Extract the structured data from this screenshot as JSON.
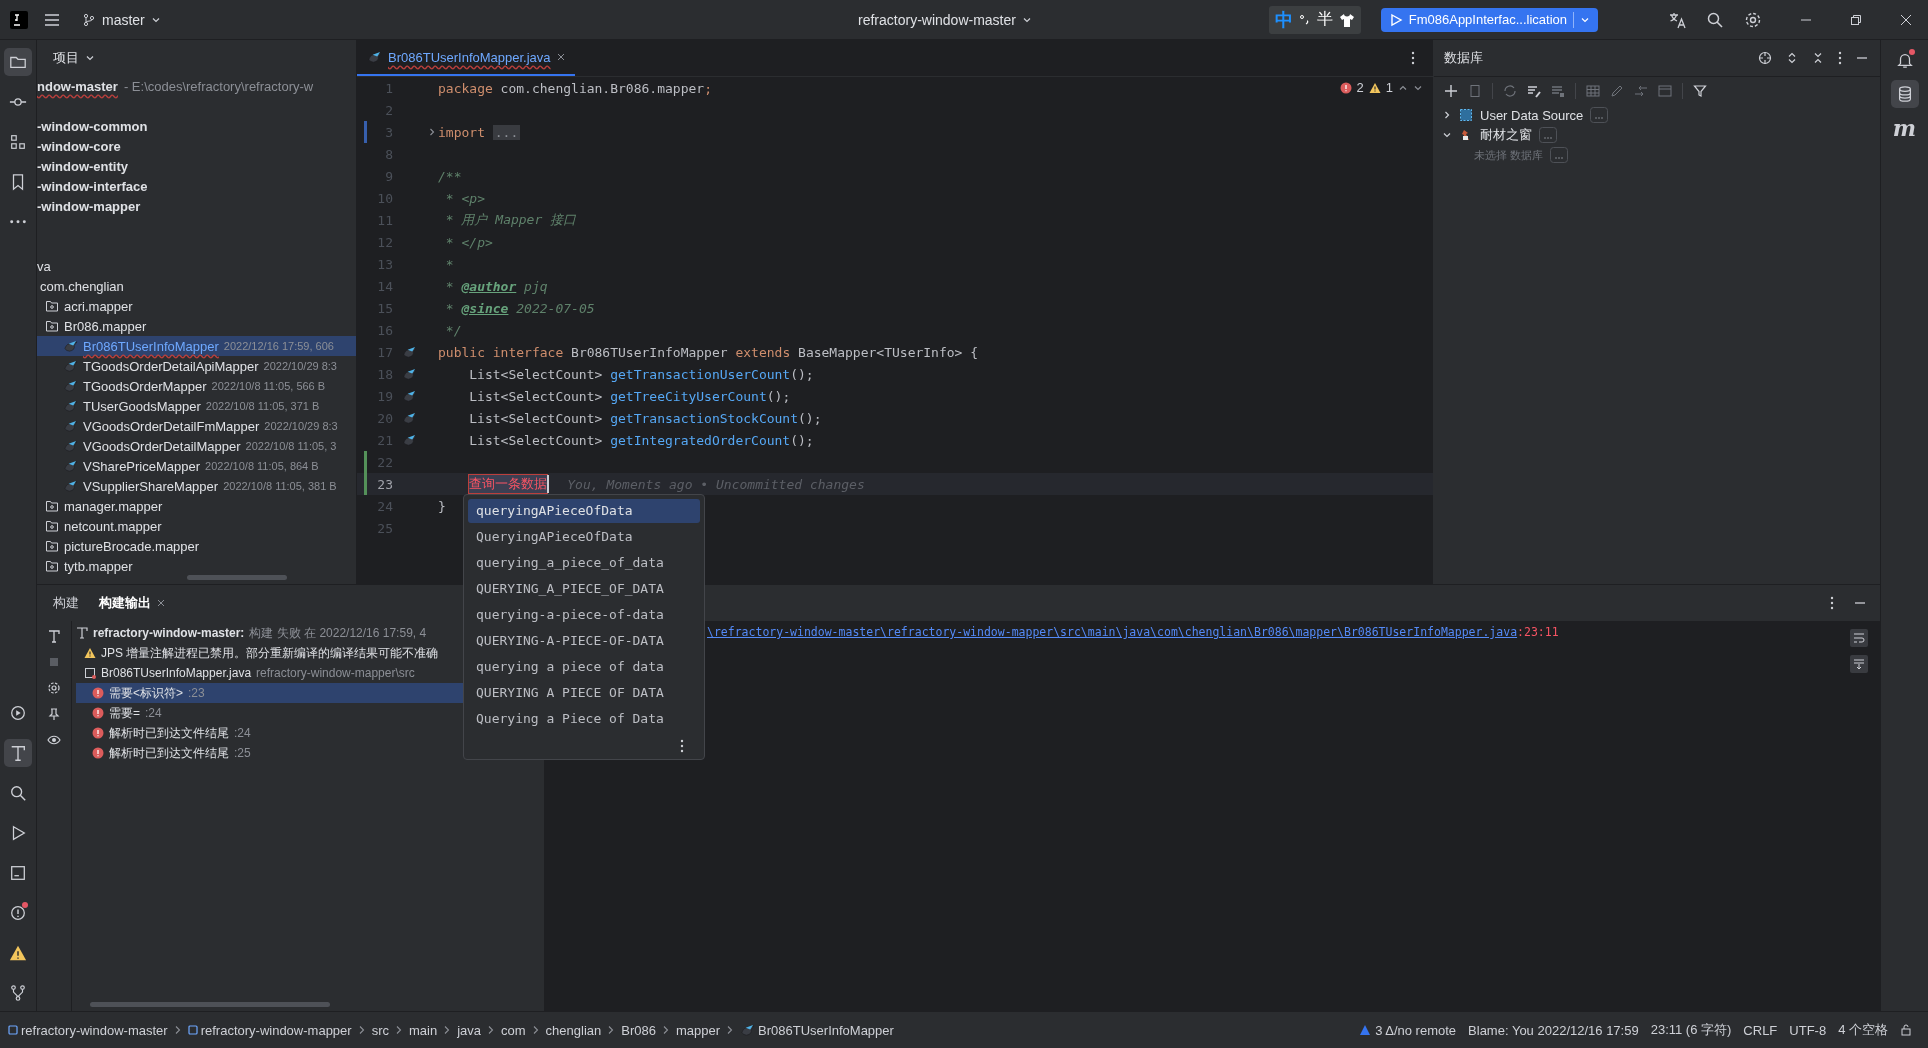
{
  "title_bar": {
    "branch": "master",
    "project": "refractory-window-master",
    "ime": [
      "中",
      "半"
    ],
    "run_config": "Fm086AppInterfac...lication"
  },
  "tool_strip": {
    "top": [
      {
        "selected": true
      },
      {
        "selected": false
      },
      {
        "selected": false
      },
      {
        "selected": false
      },
      {
        "selected": false
      }
    ],
    "bottom": [
      {
        "selected": false,
        "unread": false
      },
      {
        "selected": true,
        "unread": false
      },
      {
        "selected": false,
        "unread": false
      },
      {
        "selected": false,
        "unread": false
      },
      {
        "selected": false,
        "unread": false
      },
      {
        "selected": false,
        "unread": true
      },
      {
        "selected": false,
        "unread": false
      },
      {
        "selected": false,
        "unread": false
      }
    ]
  },
  "right_strip": [
    {
      "selected": false,
      "unread": true
    },
    {
      "selected": true,
      "unread": false
    },
    {
      "selected": false,
      "unread": false,
      "label": "m"
    }
  ],
  "project_panel": {
    "title": "项目",
    "root": {
      "name": "ndow-master",
      "path": "- E:\\codes\\refractory\\refractory-w"
    },
    "modules": [
      "-window-common",
      "-window-core",
      "-window-entity",
      "-window-interface",
      "-window-mapper"
    ],
    "tree": [
      {
        "name": "va",
        "selected": false,
        "children": [
          {
            "name": "com.chenglian",
            "selected": false,
            "children": [
              {
                "name": "acri.mapper",
                "kind": "package",
                "selected": false
              },
              {
                "name": "Br086.mapper",
                "kind": "package",
                "selected": false,
                "children": [
                  {
                    "name": "Br086TUserInfoMapper",
                    "meta": "2022/12/16 17:59, 606",
                    "kind": "mapper",
                    "selected": true
                  },
                  {
                    "name": "TGoodsOrderDetailApiMapper",
                    "meta": "2022/10/29 8:3",
                    "kind": "mapper",
                    "selected": false
                  },
                  {
                    "name": "TGoodsOrderMapper",
                    "meta": "2022/10/8 11:05, 566 B",
                    "kind": "mapper",
                    "selected": false
                  },
                  {
                    "name": "TUserGoodsMapper",
                    "meta": "2022/10/8 11:05, 371 B",
                    "kind": "mapper",
                    "selected": false
                  },
                  {
                    "name": "VGoodsOrderDetailFmMapper",
                    "meta": "2022/10/29 8:3",
                    "kind": "mapper",
                    "selected": false
                  },
                  {
                    "name": "VGoodsOrderDetailMapper",
                    "meta": "2022/10/8 11:05, 3",
                    "kind": "mapper",
                    "selected": false
                  },
                  {
                    "name": "VSharePriceMapper",
                    "meta": "2022/10/8 11:05, 864 B",
                    "kind": "mapper",
                    "selected": false
                  },
                  {
                    "name": "VSupplierShareMapper",
                    "meta": "2022/10/8 11:05, 381 B",
                    "kind": "mapper",
                    "selected": false
                  }
                ]
              },
              {
                "name": "manager.mapper",
                "kind": "package",
                "selected": false
              },
              {
                "name": "netcount.mapper",
                "kind": "package",
                "selected": false
              },
              {
                "name": "pictureBrocade.mapper",
                "kind": "package",
                "selected": false
              },
              {
                "name": "tytb.mapper",
                "kind": "package",
                "selected": false
              }
            ]
          }
        ]
      }
    ]
  },
  "editor": {
    "tab": {
      "label": "Br086TUserInfoMapper.java",
      "selected": true
    },
    "errors": "2",
    "warnings": "1",
    "lines": [
      {
        "number": "1",
        "segments": [
          {
            "text": "package",
            "kind": "kw"
          },
          {
            "text": " com.chenglian.Br086.mapper",
            "kind": "plain"
          },
          {
            "text": ";",
            "kind": "kw"
          }
        ]
      },
      {
        "number": "2"
      },
      {
        "number": "3",
        "modified": true,
        "foldable": true,
        "segments": [
          {
            "text": "import ",
            "kind": "kw"
          },
          {
            "text": "...",
            "kind": "fold"
          }
        ]
      },
      {
        "number": "8"
      },
      {
        "number": "9",
        "segments": [
          {
            "text": "/**",
            "kind": "doc"
          }
        ]
      },
      {
        "number": "10",
        "segments": [
          {
            "text": " * <p>",
            "kind": "doc"
          }
        ]
      },
      {
        "number": "11",
        "segments": [
          {
            "text": " * 用户 Mapper 接口",
            "kind": "doc"
          }
        ]
      },
      {
        "number": "12",
        "segments": [
          {
            "text": " * </p>",
            "kind": "doc"
          }
        ]
      },
      {
        "number": "13",
        "segments": [
          {
            "text": " *",
            "kind": "doc"
          }
        ]
      },
      {
        "number": "14",
        "segments": [
          {
            "text": " * ",
            "kind": "doc"
          },
          {
            "text": "@author",
            "kind": "doctag"
          },
          {
            "text": " pjq",
            "kind": "doc"
          }
        ]
      },
      {
        "number": "15",
        "segments": [
          {
            "text": " * ",
            "kind": "doc"
          },
          {
            "text": "@since",
            "kind": "doctag"
          },
          {
            "text": " 2022-07-05",
            "kind": "doc"
          }
        ]
      },
      {
        "number": "16",
        "segments": [
          {
            "text": " */",
            "kind": "doc"
          }
        ]
      },
      {
        "number": "17",
        "mapper_icon": true,
        "segments": [
          {
            "text": "public interface ",
            "kind": "kw"
          },
          {
            "text": "Br086TUserInfoMapper ",
            "kind": "plain"
          },
          {
            "text": "extends ",
            "kind": "kw"
          },
          {
            "text": "BaseMapper<TUserInfo> {",
            "kind": "plain"
          }
        ]
      },
      {
        "number": "18",
        "mapper_icon": true,
        "indented": true,
        "segments": [
          {
            "text": "List<SelectCount> ",
            "kind": "plain"
          },
          {
            "text": "getTransactionUserCount",
            "kind": "fn"
          },
          {
            "text": "();",
            "kind": "plain"
          }
        ]
      },
      {
        "number": "19",
        "mapper_icon": true,
        "indented": true,
        "segments": [
          {
            "text": "List<SelectCount> ",
            "kind": "plain"
          },
          {
            "text": "getTreeCityUserCount",
            "kind": "fn"
          },
          {
            "text": "();",
            "kind": "plain"
          }
        ]
      },
      {
        "number": "20",
        "mapper_icon": true,
        "indented": true,
        "segments": [
          {
            "text": "List<SelectCount> ",
            "kind": "plain"
          },
          {
            "text": "getTransactionStockCount",
            "kind": "fn"
          },
          {
            "text": "();",
            "kind": "plain"
          }
        ]
      },
      {
        "number": "21",
        "mapper_icon": true,
        "indented": true,
        "segments": [
          {
            "text": "List<SelectCount> ",
            "kind": "plain"
          },
          {
            "text": "getIntegratedOrderCount",
            "kind": "fn"
          },
          {
            "text": "();",
            "kind": "plain"
          }
        ]
      },
      {
        "number": "22",
        "added": true
      },
      {
        "number": "23",
        "added": true,
        "current": true,
        "indented": true,
        "segments": [
          {
            "text": "查询一条数据",
            "kind": "error"
          }
        ],
        "hint": "You, Moments ago • Uncommitted changes"
      },
      {
        "number": "24",
        "segments": [
          {
            "text": "}",
            "kind": "plain"
          }
        ]
      },
      {
        "number": "25"
      }
    ]
  },
  "completion_popup": {
    "items": [
      {
        "text": "queryingAPieceOfData",
        "selected": true
      },
      {
        "text": "QueryingAPieceOfData",
        "selected": false
      },
      {
        "text": "querying_a_piece_of_data",
        "selected": false
      },
      {
        "text": "QUERYING_A_PIECE_OF_DATA",
        "selected": false
      },
      {
        "text": "querying-a-piece-of-data",
        "selected": false
      },
      {
        "text": "QUERYING-A-PIECE-OF-DATA",
        "selected": false
      },
      {
        "text": "querying a piece of data",
        "selected": false
      },
      {
        "text": "QUERYING A PIECE OF DATA",
        "selected": false
      },
      {
        "text": "Querying a Piece of Data",
        "selected": false
      }
    ]
  },
  "database_panel": {
    "title": "数据库",
    "tree": [
      {
        "name": "User Data Source",
        "expanded": false,
        "kind": "source"
      },
      {
        "name": "耐材之窗",
        "expanded": true,
        "kind": "project",
        "children": [
          {
            "name": "未选择 数据库"
          }
        ]
      }
    ]
  },
  "bottom_panel": {
    "tabs": [
      {
        "label": "构建",
        "selected": false,
        "closable": false
      },
      {
        "label": "构建输出",
        "selected": true,
        "closable": true
      }
    ],
    "build_tree": [
      {
        "kind": "root",
        "title": "refractory-window-master:",
        "detail": "构建 失败 在 2022/12/16 17:59, 4",
        "selected": false,
        "children": [
          {
            "kind": "warning",
            "title": "JPS 增量注解进程已禁用。部分重新编译的编译结果可能不准确",
            "selected": false
          },
          {
            "kind": "file",
            "title": "Br086TUserInfoMapper.java",
            "detail": "refractory-window-mapper\\src",
            "selected": false,
            "children": [
              {
                "kind": "error",
                "title": "需要<标识符>",
                "detail": ":23",
                "selected": true
              },
              {
                "kind": "error",
                "title": "需要=",
                "detail": ":24",
                "selected": false
              },
              {
                "kind": "error",
                "title": "解析时已到达文件结尾",
                "detail": ":24",
                "selected": false
              },
              {
                "kind": "error",
                "title": "解析时已到达文件结尾",
                "detail": ":25",
                "selected": false
              }
            ]
          }
        ]
      }
    ],
    "console": {
      "path": "\\refractory-window-master\\refractory-window-mapper\\src\\main\\java\\com\\chenglian\\Br086\\mapper\\Br086TUserInfoMapper.java",
      "position": ":23:11"
    }
  },
  "status_bar": {
    "breadcrumbs": [
      {
        "text": "refractory-window-master",
        "kind": "module"
      },
      {
        "text": "refractory-window-mapper",
        "kind": "module"
      },
      {
        "text": "src",
        "kind": "folder"
      },
      {
        "text": "main",
        "kind": "folder"
      },
      {
        "text": "java",
        "kind": "folder"
      },
      {
        "text": "com",
        "kind": "folder"
      },
      {
        "text": "chenglian",
        "kind": "folder"
      },
      {
        "text": "Br086",
        "kind": "folder"
      },
      {
        "text": "mapper",
        "kind": "folder"
      },
      {
        "text": "Br086TUserInfoMapper",
        "kind": "mapper"
      }
    ],
    "vcs": "3 Δ/no remote",
    "blame": "Blame: You 2022/12/16 17:59",
    "caret": "23:11 (6 字符)",
    "line_separator": "CRLF",
    "encoding": "UTF-8",
    "indent": "4 个空格"
  }
}
